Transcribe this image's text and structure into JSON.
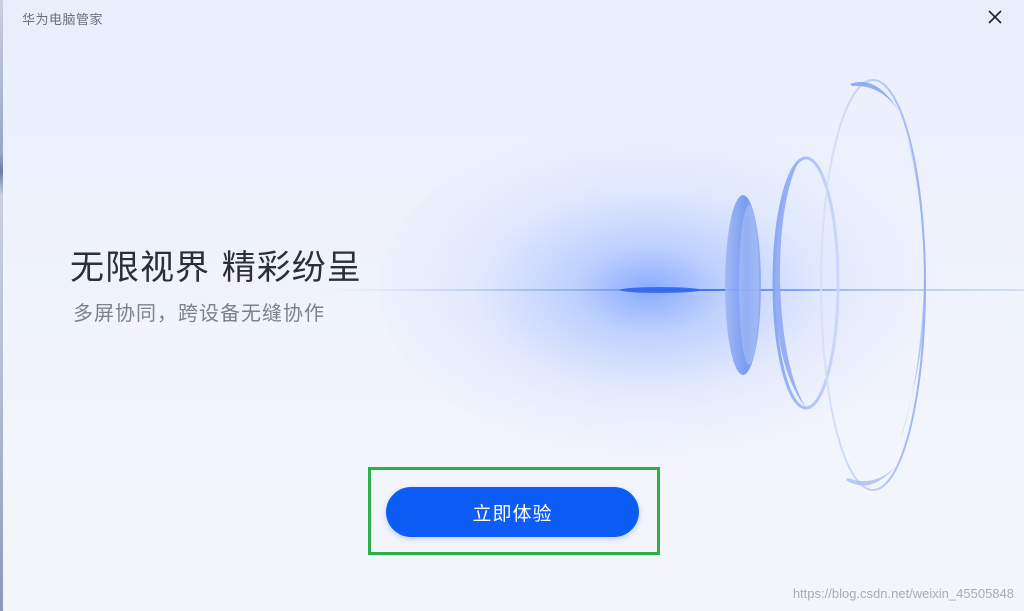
{
  "window": {
    "title": "华为电脑管家",
    "close_icon": "close-icon"
  },
  "promo": {
    "headline": "无限视界 精彩纷呈",
    "subtitle": "多屏协同，跨设备无缝协作"
  },
  "cta": {
    "label": "立即体验"
  },
  "watermark": {
    "text": "https://blog.csdn.net/weixin_45505848"
  },
  "colors": {
    "accent": "#0d5cf5",
    "highlight_box": "#2cb04a",
    "headline": "#2b2f36",
    "subtitle": "#7d8189"
  }
}
